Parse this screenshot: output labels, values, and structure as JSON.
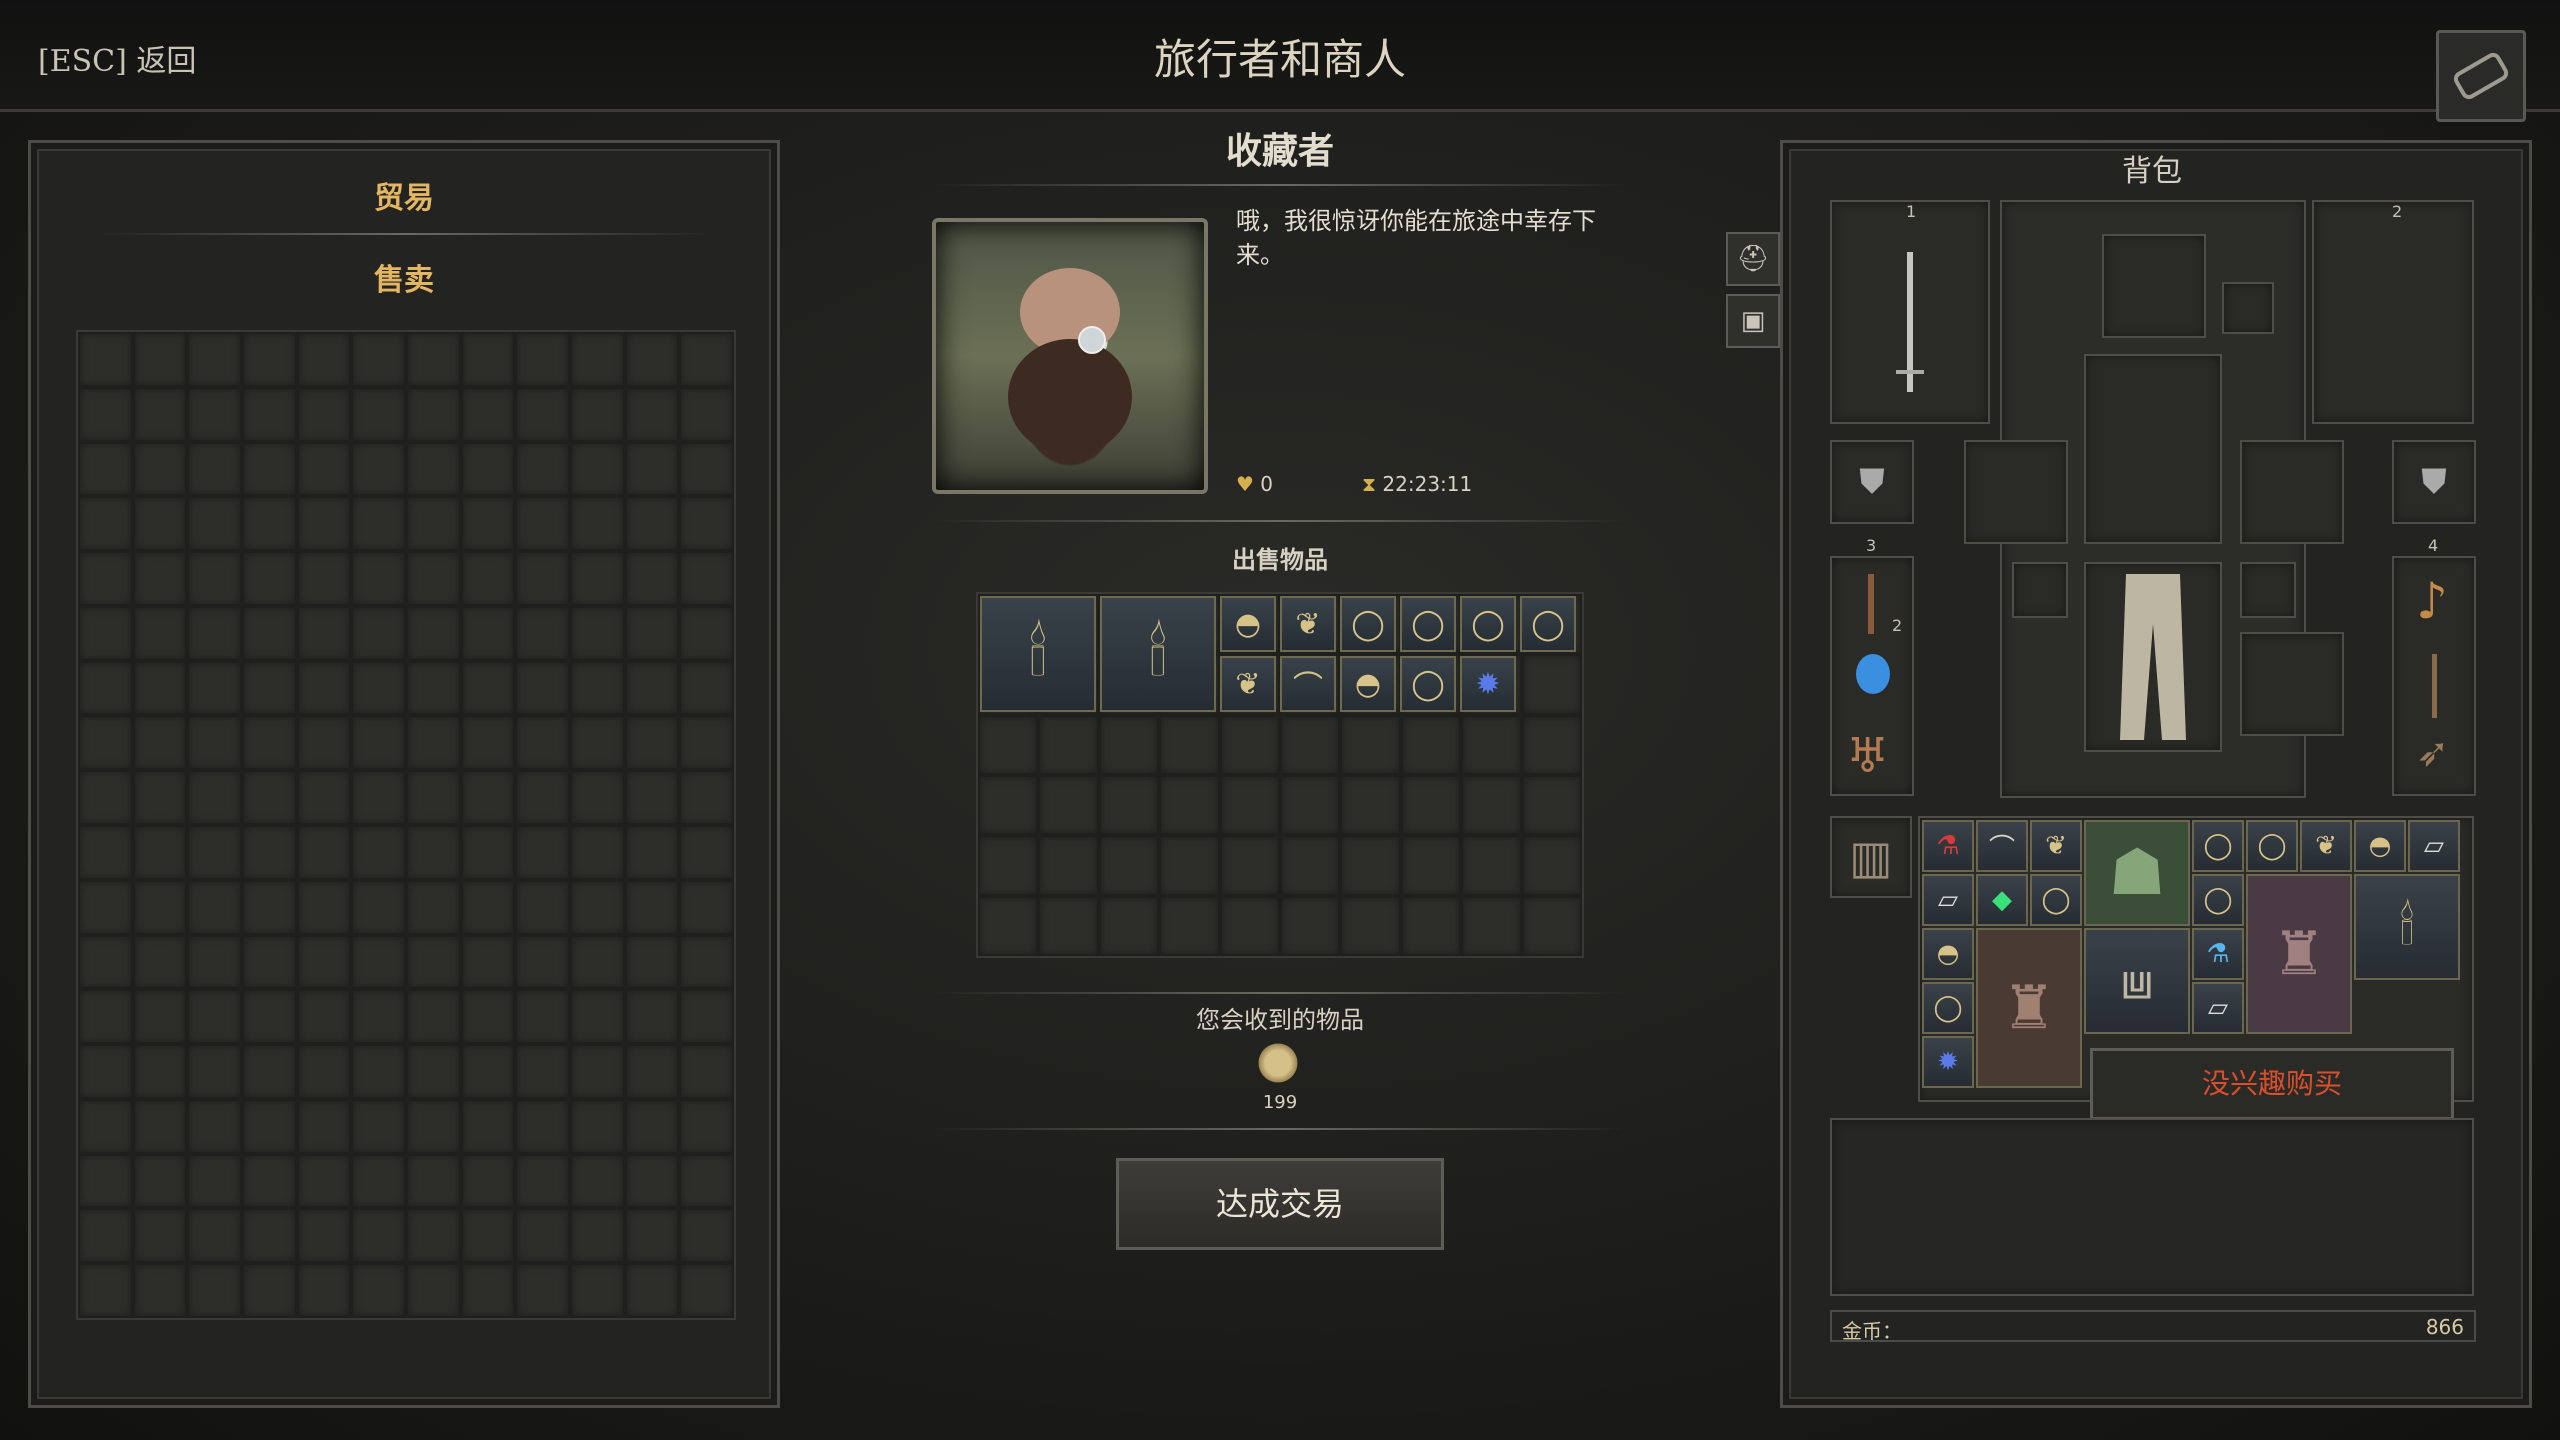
{
  "header": {
    "back_label": "[ESC] 返回",
    "title": "旅行者和商人"
  },
  "trade_panel": {
    "tab_trade": "贸易",
    "tab_sell": "售卖"
  },
  "merchant": {
    "name": "收藏者",
    "dialog": "哦，我很惊讶你能在旅途中幸存下来。",
    "reputation": "0",
    "timer": "22:23:11"
  },
  "sale": {
    "heading": "出售物品"
  },
  "receive": {
    "heading": "您会收到的物品",
    "amount": "199"
  },
  "deal_button": "达成交易",
  "backpack": {
    "title": "背包",
    "slot_labels": [
      "1",
      "2",
      "3",
      "4"
    ],
    "stack_count": "2",
    "gold_label": "金币：",
    "gold_value": "866",
    "tooltip": "没兴趣购买"
  },
  "colors": {
    "accent_tab": "#e3b662",
    "tooltip_text": "#d84f2d"
  },
  "icons": [
    "candlestick-icon",
    "bowl-icon",
    "golden-chalice-icon",
    "ring-icon",
    "necklace-icon",
    "sapphire-icon",
    "gold-coins-icon",
    "sword-icon",
    "potion-icon",
    "lyre-icon",
    "lute-icon",
    "armor-icon"
  ]
}
